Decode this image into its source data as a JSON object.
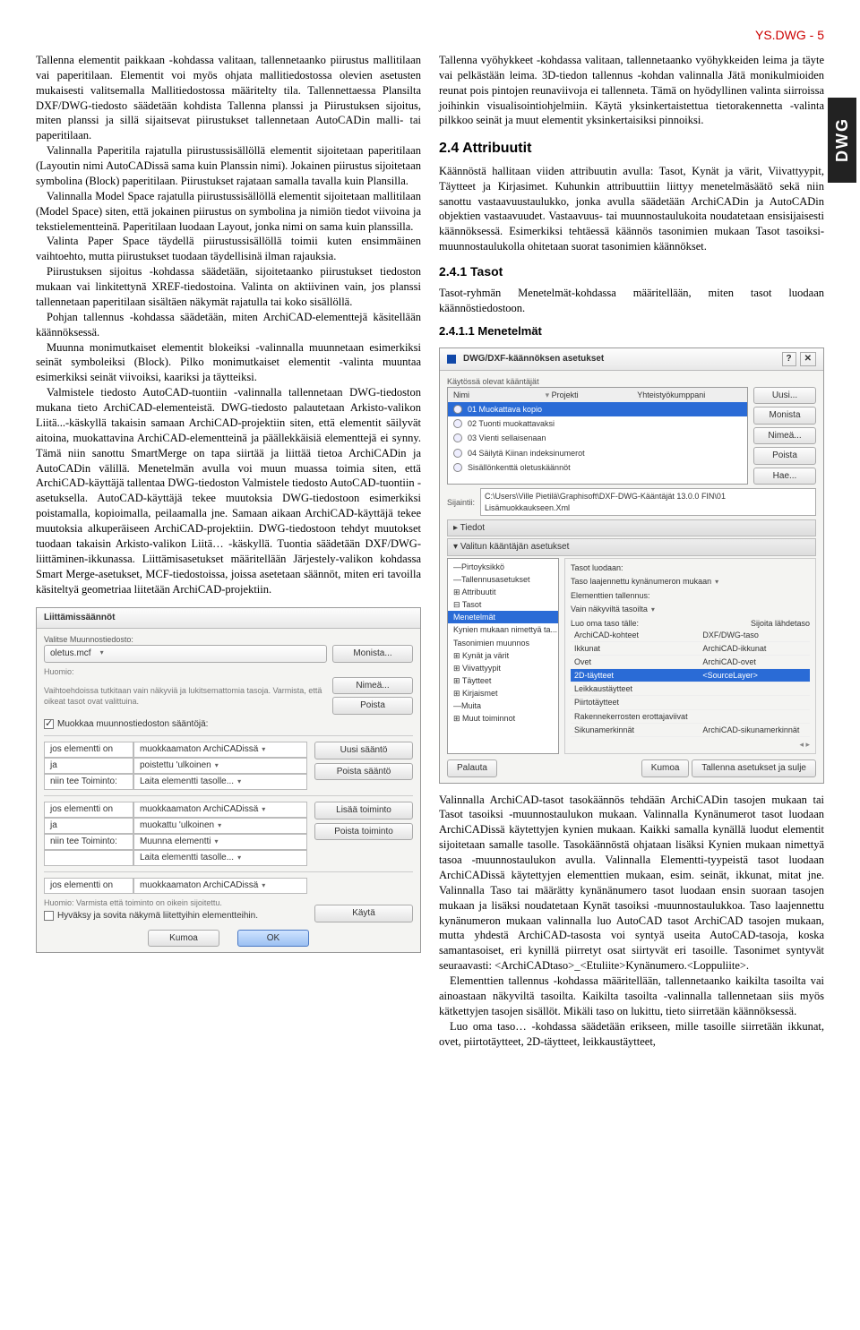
{
  "header": {
    "pageId": "YS.DWG - 5"
  },
  "sidetab": "DWG",
  "left": {
    "p1": "Tallenna elementit paikkaan -kohdassa valitaan, tallennetaanko piirustus mallitilaan vai paperitilaan. Elementit voi myös ohjata mallitiedostossa olevien asetusten mukaisesti valitsemalla Mallitiedostossa määritelty tila. Tallennettaessa Plansilta DXF/DWG-tiedosto säädetään kohdista Tallenna planssi ja Piirustuksen sijoitus, miten planssi ja sillä sijaitsevat piirustukset tallennetaan AutoCADin malli- tai paperitilaan.",
    "p2": "Valinnalla Paperitila rajatulla piirustussisällöllä elementit sijoitetaan paperitilaan (Layoutin nimi AutoCADissä sama kuin Planssin nimi). Jokainen piirustus sijoitetaan symbolina (Block) paperitilaan. Piirustukset rajataan samalla tavalla kuin Plansilla.",
    "p3": "Valinnalla Model Space rajatulla piirustussisällöllä elementit sijoitetaan mallitilaan (Model Space) siten, että jokainen piirustus on symbolina ja nimiön tiedot viivoina ja tekstielementteinä. Paperitilaan luodaan Layout, jonka nimi on sama kuin planssilla.",
    "p4": "Valinta Paper Space täydellä piirustussisällöllä toimii kuten ensimmäinen vaihtoehto, mutta piirustukset tuodaan täydellisinä ilman rajauksia.",
    "p5": "Piirustuksen sijoitus -kohdassa säädetään, sijoitetaanko piirustukset tiedoston mukaan vai linkitettynä XREF-tiedostoina. Valinta on aktiivinen vain, jos planssi tallennetaan paperitilaan sisältäen näkymät rajatulla tai koko sisällöllä.",
    "p6": "Pohjan tallennus -kohdassa säädetään, miten ArchiCAD-elementtejä käsitellään käännöksessä.",
    "p7": "Muunna monimutkaiset elementit blokeiksi -valinnalla muunnetaan esimerkiksi seinät symboleiksi (Block). Pilko monimutkaiset elementit -valinta muuntaa esimerkiksi seinät viivoiksi, kaariksi ja täytteiksi.",
    "p8": "Valmistele tiedosto AutoCAD-tuontiin -valinnalla tallennetaan DWG-tiedoston mukana tieto ArchiCAD-elementeistä. DWG-tiedosto palautetaan Arkisto-valikon Liitä...-käskyllä takaisin samaan ArchiCAD-projektiin siten, että elementit säilyvät aitoina, muokattavina ArchiCAD-elementteinä ja päällekkäisiä elementtejä ei synny. Tämä niin sanottu SmartMerge on tapa siirtää ja liittää tietoa ArchiCADin ja AutoCADin välillä. Menetelmän avulla voi muun muassa toimia siten, että ArchiCAD-käyttäjä tallentaa DWG-tiedoston Valmistele tiedosto AutoCAD-tuontiin -asetuksella. AutoCAD-käyttäjä tekee muutoksia DWG-tiedostoon esimerkiksi poistamalla, kopioimalla, peilaamalla jne. Samaan aikaan ArchiCAD-käyttäjä tekee muutoksia alkuperäiseen ArchiCAD-projektiin. DWG-tiedostoon tehdyt muutokset tuodaan takaisin Arkisto-valikon Liitä… -käskyllä. Tuontia säädetään DXF/DWG-liittäminen-ikkunassa. Liittämisasetukset määritellään Järjestely-valikon kohdassa Smart Merge-asetukset, MCF-tiedostoissa, joissa asetetaan säännöt, miten eri tavoilla käsiteltyä geometriaa liitetään ArchiCAD-projektiin."
  },
  "right": {
    "p1": "Tallenna vyöhykkeet -kohdassa valitaan, tallennetaanko vyöhykkeiden leima ja täyte vai pelkästään leima. 3D-tiedon tallennus -kohdan valinnalla Jätä monikulmioiden reunat pois pintojen reunaviivoja ei tallenneta. Tämä on hyödyllinen valinta siirroissa joihinkin visualisointiohjelmiin. Käytä yksinkertaistettua tietorakennetta -valinta pilkkoo seinät ja muut elementit yksinkertaisiksi pinnoiksi.",
    "h24": "2.4   Attribuutit",
    "p2": "Käännöstä hallitaan viiden attribuutin avulla: Tasot, Kynät ja värit, Viivattyypit, Täytteet ja Kirjasimet. Kuhunkin attribuuttiin liittyy menetelmäsäätö sekä niin sanottu vastaavuustaulukko, jonka avulla säädetään ArchiCADin ja AutoCADin objektien vastaavuudet. Vastaavuus- tai muunnostaulukoita noudatetaan ensisijaisesti käännöksessä. Esimerkiksi tehtäessä käännös tasonimien mukaan Tasot tasoiksi-muunnostaulukolla ohitetaan suorat tasonimien käännökset.",
    "h241": "2.4.1   Tasot",
    "p3": "Tasot-ryhmän Menetelmät-kohdassa määritellään, miten tasot luodaan käännöstiedostoon.",
    "h2411": "2.4.1.1 Menetelmät",
    "p4": "Valinnalla ArchiCAD-tasot tasokäännös tehdään ArchiCADin tasojen mukaan tai Tasot tasoiksi -muunnostaulukon mukaan. Valinnalla Kynänumerot tasot luodaan ArchiCADissä käytettyjen kynien mukaan. Kaikki samalla kynällä luodut elementit sijoitetaan samalle tasolle. Tasokäännöstä ohjataan lisäksi Kynien mukaan nimettyä tasoa -muunnostaulukon avulla. Valinnalla Elementti-tyypeistä tasot luodaan ArchiCADissä käytettyjen elementtien mukaan, esim. seinät, ikkunat, mitat jne. Valinnalla Taso tai määrätty kynänänumero tasot luodaan ensin suoraan tasojen mukaan ja lisäksi noudatetaan Kynät tasoiksi -muunnostaulukkoa. Taso laajennettu kynänumeron mukaan valinnalla luo AutoCAD tasot ArchiCAD tasojen mukaan, mutta yhdestä ArchiCAD-tasosta voi syntyä useita AutoCAD-tasoja, koska samantasoiset, eri kynillä piirretyt osat siirtyvät eri tasoille. Tasonimet syntyvät seuraavasti: <ArchiCADtaso>_<Etuliite>Kynänumero.<Loppuliite>.",
    "p5": "Elementtien tallennus -kohdassa määritellään, tallennetaanko kaikilta tasoilta vai ainoastaan näkyviltä tasoilta. Kaikilta tasoilta -valinnalla tallennetaan siis myös kätkettyjen tasojen sisällöt. Mikäli taso on lukittu, tieto siirretään käännöksessä.",
    "p6": "Luo oma taso… -kohdassa säädetään erikseen, mille tasoille siirretään ikkunat, ovet, piirtotäytteet, 2D-täytteet, leikkaustäytteet,"
  },
  "fig2": {
    "title": "Liittämissäännöt",
    "selectLabel": "Valitse Muunnostiedosto:",
    "file": "oletus.mcf",
    "hint": "Huomio:",
    "hintText": "Vaihtoehdoissa tutkitaan vain näkyviä ja lukitsemattomia tasoja. Varmista, että oikeat tasot ovat valittuina.",
    "editRules": "Muokkaa muunnostiedoston sääntöjä:",
    "btnMonista": "Monista...",
    "btnNimea": "Nimeä...",
    "btnPoista": "Poista",
    "btnUusiSaanto": "Uusi sääntö",
    "btnPoistaSaanto": "Poista sääntö",
    "btnLisaaToiminto": "Lisää toiminto",
    "btnPoistaToiminto": "Poista toiminto",
    "r1a": "jos elementti on",
    "r1b": "muokkaamaton ArchiCADissä",
    "r2a": "ja",
    "r2b": "poistettu 'ulkoinen",
    "r3a": "niin tee Toiminto:",
    "r3b": "Laita elementti tasolle...",
    "r4a": "jos elementti on",
    "r4b": "muokkaamaton ArchiCADissä",
    "r5a": "ja",
    "r5b": "muokattu 'ulkoinen",
    "r6a": "niin tee Toiminto:",
    "r6b": "Muunna elementti",
    "r7b": "Laita elementti tasolle...",
    "r8a": "jos elementti on",
    "r8b": "muokkaamaton ArchiCADissä",
    "footnote": "Huomio: Varmista että toiminto on oikein sijoitettu.",
    "chk": "Hyväksy ja sovita näkymä liitettyihin elementteihin.",
    "btnKayta": "Käytä",
    "btnKumoa": "Kumoa",
    "btnOK": "OK"
  },
  "fig1": {
    "title": "DWG/DXF-käännöksen asetukset",
    "topLabel": "Käytössä olevat kääntäjät",
    "colName": "Nimi",
    "colProj": "Projekti",
    "colYht": "Yhteistyökumppani",
    "items": [
      "01 Muokattava kopio",
      "02 Tuonti muokattavaksi",
      "03 Vienti sellaisenaan",
      "04 Säilytä Kiinan indeksinumerot",
      "Sisällönkenttä oletuskäännöt"
    ],
    "btnUusi": "Uusi...",
    "btnMonista": "Monista",
    "btnNimea": "Nimeä...",
    "btnPoista": "Poista",
    "btnHae": "Hae...",
    "sijLabel": "Sijaintii:",
    "path": "C:\\Users\\Ville Pietilä\\Graphisoft\\DXF-DWG-Kääntäjät 13.0.0 FIN\\01 Lisämuokkaukseen.Xml",
    "secTiedot": "Tiedot",
    "secValitun": "Valitun kääntäjän asetukset",
    "tree": [
      "—Pirtoyksikkö",
      "—Tallennusasetukset",
      "⊞ Attribuutit",
      "  ⊟ Tasot",
      "      Menetelmät",
      "      Kynien mukaan nimettyä ta...",
      "      Tasonimien muunnos",
      "  ⊞ Kynät ja värit",
      "  ⊞ Viivattyypit",
      "  ⊞ Täytteet",
      "  ⊞ Kirjaismet",
      "—Muita",
      "⊞ Muut toiminnot"
    ],
    "treeSel": 4,
    "panelTitle": "Tasot luodaan:",
    "dd": "Taso laajennettu kynänumeron mukaan",
    "elLabel": "Elementtien tallennus:",
    "ddEl": "Vain näkyviltä tasoilta",
    "luoLabel": "Luo oma taso tälle:",
    "sijLah": "Sijoita lähdetaso",
    "tbl": [
      [
        "ArchiCAD-kohteet",
        "DXF/DWG-taso"
      ],
      [
        "Ikkunat",
        "ArchiCAD-ikkunat"
      ],
      [
        "Ovet",
        "ArchiCAD-ovet"
      ],
      [
        "2D-täytteet",
        "<SourceLayer>"
      ],
      [
        "Leikkaustäytteet",
        ""
      ],
      [
        "Piirtotäytteet",
        ""
      ],
      [
        "Rakennekerrosten erottajaviivat",
        ""
      ],
      [
        "Sikunamerkinnät",
        "ArchiCAD-sikunamerkinnät"
      ]
    ],
    "tblSel": 3,
    "btnPalauta": "Palauta",
    "btnKumoa": "Kumoa",
    "btnTallenna": "Tallenna asetukset ja sulje"
  }
}
